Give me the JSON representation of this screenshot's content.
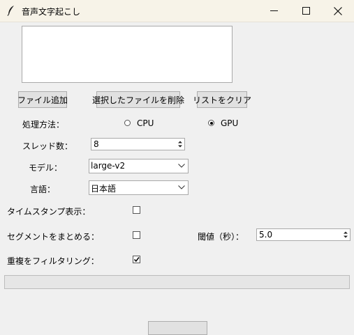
{
  "window": {
    "title": "音声文字起こし",
    "icon": "feather-icon"
  },
  "file_list": {
    "items": []
  },
  "buttons": {
    "add_file": "ファイル追加",
    "remove_selected": "選択したファイルを削除",
    "clear_list": "リストをクリア"
  },
  "processing": {
    "label": "処理方法：",
    "options": [
      "CPU",
      "GPU"
    ],
    "selected": "GPU"
  },
  "threads": {
    "label": "スレッド数：",
    "value": "8"
  },
  "model": {
    "label": "モデル：",
    "value": "large-v2"
  },
  "language": {
    "label": "言語：",
    "value": "日本語"
  },
  "timestamp": {
    "label": "タイムスタンプ表示：",
    "checked": false
  },
  "segment": {
    "label": "セグメントをまとめる：",
    "checked": false
  },
  "threshold": {
    "label": "閾値（秒）：",
    "value": "5.0"
  },
  "dedupe": {
    "label": "重複をフィルタリング：",
    "checked": true
  },
  "progress": {
    "fraction": 0
  }
}
